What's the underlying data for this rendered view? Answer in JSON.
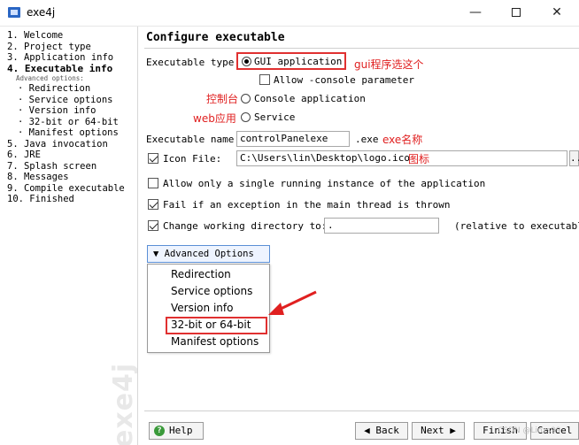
{
  "window": {
    "title": "exe4j",
    "minimize": "—",
    "close": "✕"
  },
  "sidebar": {
    "steps": [
      "1. Welcome",
      "2. Project type",
      "3. Application info",
      "4. Executable info",
      "Advanced options:",
      "· Redirection",
      "· Service options",
      "· Version info",
      "· 32-bit or 64-bit",
      "· Manifest options",
      "5. Java invocation",
      "6. JRE",
      "7. Splash screen",
      "8. Messages",
      "9. Compile executable",
      "10. Finished"
    ],
    "watermark": "exe4j"
  },
  "main": {
    "title": "Configure executable",
    "exe_type_label": "Executable type:",
    "type_gui": "GUI application",
    "allow_console": "Allow -console parameter",
    "type_console": "Console application",
    "type_service": "Service",
    "exe_name_label": "Executable name:",
    "exe_name_value": "controlPanelexe",
    "exe_suffix": ".exe",
    "icon_label": "Icon File:",
    "icon_value": "C:\\Users\\lin\\Desktop\\logo.ico",
    "icon_browse": "...",
    "single_instance": "Allow only a single running instance of the application",
    "fail_exception": "Fail if an exception in the main thread is thrown",
    "change_dir_label": "Change working directory to:",
    "change_dir_value": ".",
    "relative_note": "(relative to executable)",
    "advanced_button": "▼ Advanced Options",
    "advanced_menu": [
      "Redirection",
      "Service options",
      "Version info",
      "32-bit or 64-bit",
      "Manifest options"
    ]
  },
  "annotations": {
    "gui": "gui程序选这个",
    "console": "控制台",
    "service": "web应用",
    "exe_name": "exe名称",
    "icon": "图标",
    "color": "#e02020"
  },
  "footer": {
    "help": "Help",
    "back": "◀ Back",
    "next": "Next ▶",
    "finish": "Finish",
    "cancel": "Cancel",
    "credit": "CSDN @Linzs99"
  }
}
